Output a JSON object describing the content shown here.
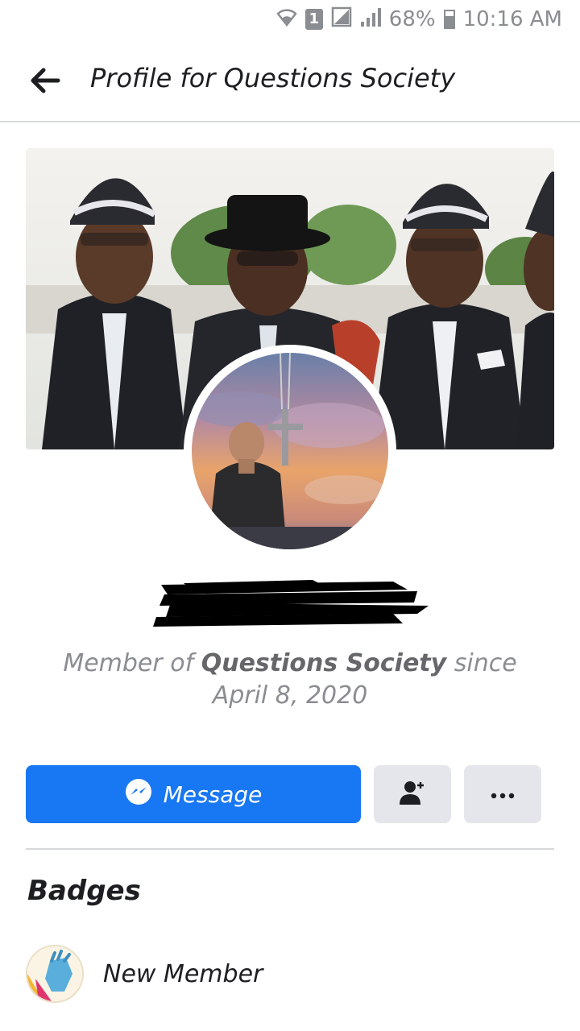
{
  "status_bar": {
    "sim_slot": "1",
    "battery": "68%",
    "time": "10:16 AM"
  },
  "header": {
    "title": "Profile for Questions Society",
    "back_icon": "arrow-left-icon"
  },
  "profile": {
    "member_prefix": "Member of",
    "group_name": "Questions Society",
    "member_suffix": "since April 8, 2020"
  },
  "actions": {
    "message_label": "Message",
    "message_icon": "messenger-icon",
    "add_friend_icon": "add-friend-icon",
    "more_icon": "more-icon"
  },
  "badges": {
    "title": "Badges",
    "items": [
      {
        "label": "New Member",
        "icon": "waving-hand-icon"
      }
    ]
  },
  "colors": {
    "primary": "#1877f2",
    "secondary_button": "#e4e6eb",
    "muted_text": "#8a8d91"
  }
}
